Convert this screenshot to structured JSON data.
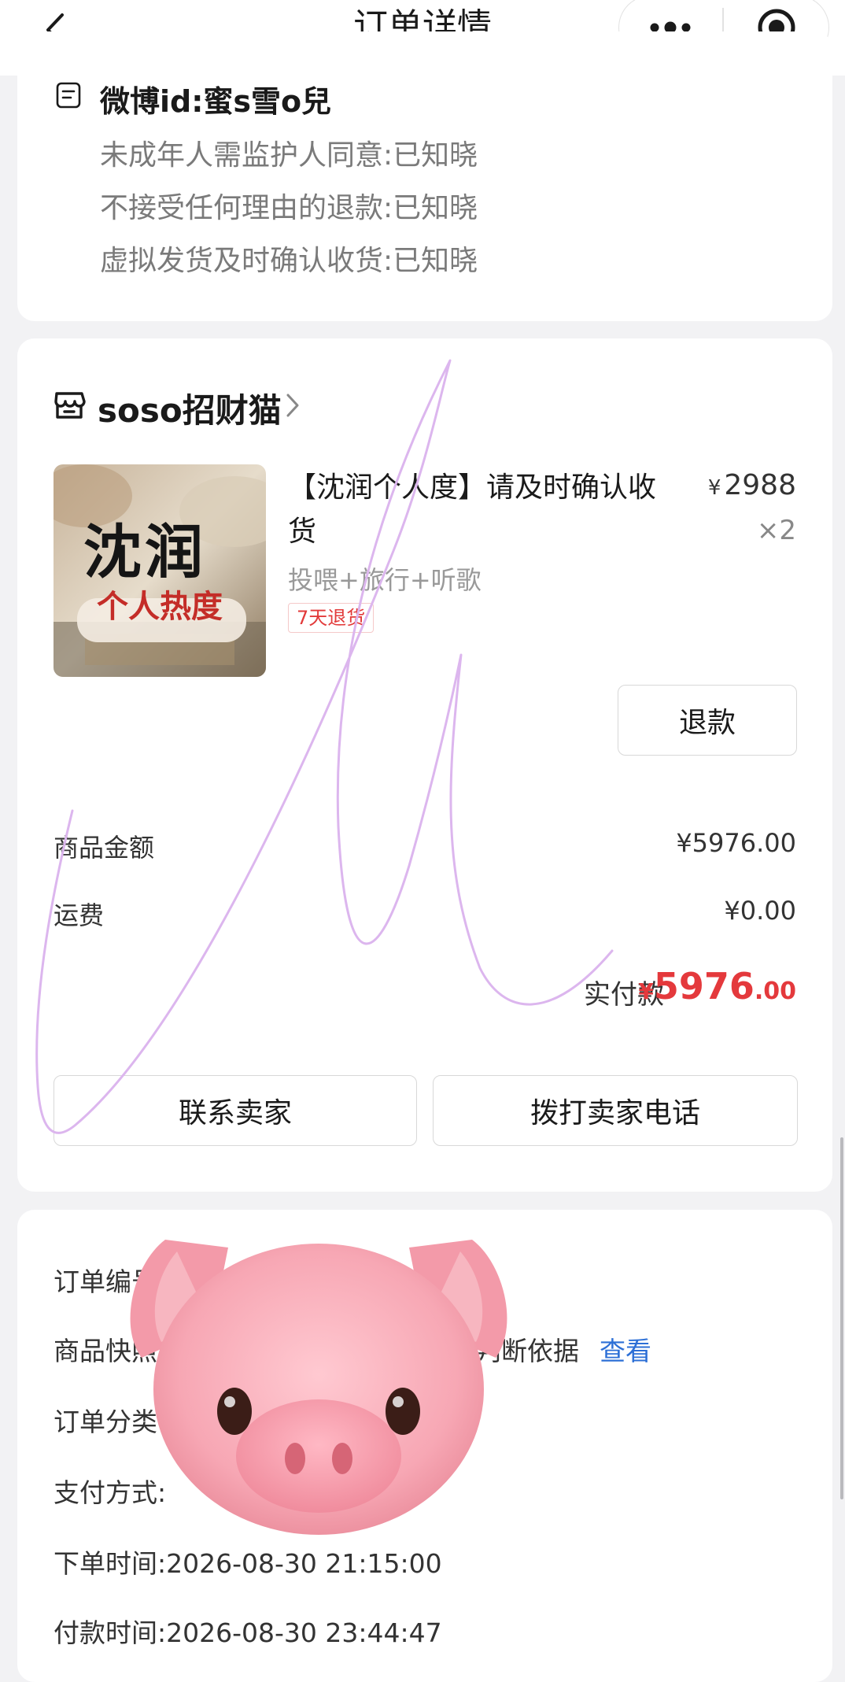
{
  "nav": {
    "title": "订单详情",
    "back_icon": "chevron-left-icon",
    "more_icon": "more-dots-icon",
    "close_icon": "target-close-icon"
  },
  "buyer_info": {
    "id_line": "微博id:蜜s雪o兒",
    "notes": [
      "未成年人需监护人同意:已知晓",
      "不接受任何理由的退款:已知晓",
      "虚拟发货及时确认收货:已知晓"
    ]
  },
  "store": {
    "name": "soso招财猫",
    "icon": "store-icon"
  },
  "product": {
    "thumb_big_text": "沈润",
    "thumb_small_text": "个人热度",
    "title": "【沈润个人度】请及时确认收货",
    "spec": "投喂+旅行+听歌",
    "badge": "7天退货",
    "price_symbol": "¥",
    "price": "2988",
    "quantity": "×2",
    "refund_label": "退款"
  },
  "summary": {
    "goods_amount_label": "商品金额",
    "goods_amount_value": "¥5976.00",
    "shipping_label": "运费",
    "shipping_value": "¥0.00",
    "paid_label": "实付款",
    "paid_symbol": "¥",
    "paid_int": "5976",
    "paid_dec": ".00"
  },
  "actions": {
    "contact_label": "联系卖家",
    "call_label": "拨打卖家电话"
  },
  "order_info": {
    "order_no_label": "订单编号",
    "snapshot_label": "商品快照",
    "snapshot_tail": "判断依据",
    "snapshot_link": "查看",
    "category_label": "订单分类",
    "pay_method_label": "支付方式:",
    "order_time": "下单时间:2026-08-30 21:15:00",
    "pay_time": "付款时间:2026-08-30 23:44:47"
  },
  "colors": {
    "accent_red": "#e4393c",
    "link_blue": "#2c6fd6",
    "doodle_purple": "#dcb6ee",
    "sticker_pink": "#f5a3b0"
  }
}
